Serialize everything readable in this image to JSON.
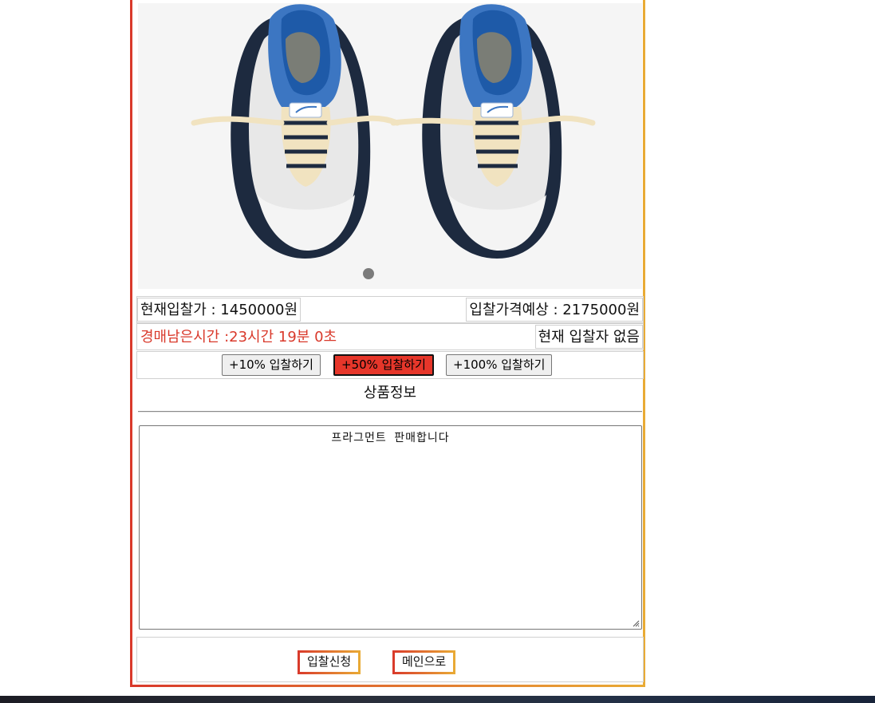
{
  "product": {
    "image_alt": "sneakers-image"
  },
  "bid_info": {
    "current_bid": "현재입찰가 : 1450000원",
    "expected_bid": "입찰가격예상 : 2175000원",
    "time_left": "경매남은시간 :23시간 19분 0초",
    "bidder_status": "현재 입찰자 없음"
  },
  "bid_buttons": {
    "plus10": "+10% 입찰하기",
    "plus50": "+50% 입찰하기",
    "plus100": "+100% 입찰하기"
  },
  "section": {
    "title": "상품정보"
  },
  "description": {
    "text": "프라그먼트 판매합니다"
  },
  "footer": {
    "submit_label": "입찰신청",
    "main_label": "메인으로"
  },
  "colors": {
    "accent_red": "#d9392b",
    "accent_orange": "#e9ab35",
    "active_button": "#e6362a"
  }
}
